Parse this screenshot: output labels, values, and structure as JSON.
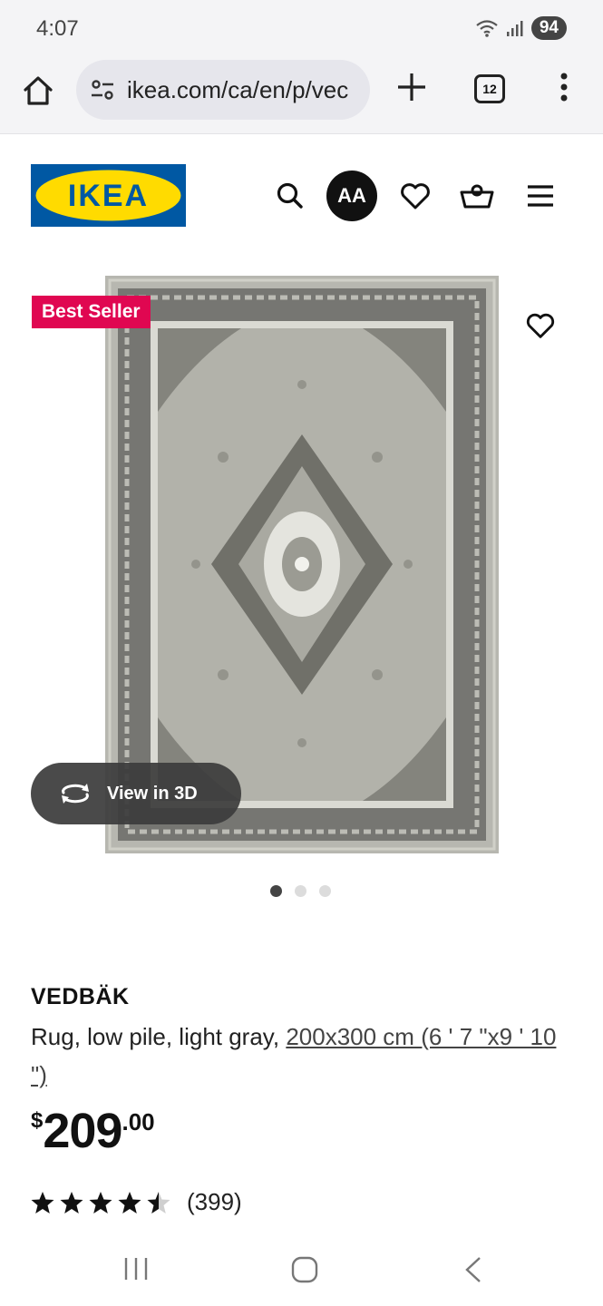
{
  "status": {
    "time": "4:07",
    "battery": "94"
  },
  "browser": {
    "url": "ikea.com/ca/en/p/vec",
    "tab_count": "12"
  },
  "header": {
    "logo_text": "IKEA",
    "avatar_initials": "AA"
  },
  "product": {
    "badge": "Best Seller",
    "view_3d": "View in 3D",
    "image_count": 3,
    "active_image": 1,
    "name": "VEDBÄK",
    "desc_prefix": "Rug, low pile, light gray, ",
    "size_link": "200x300 cm (6 ' 7 \"x9 ' 10 \")",
    "price": {
      "currency": "$",
      "integer": "209",
      "decimal": ".00"
    },
    "rating": {
      "value": 4.5,
      "max": 5,
      "count": "(399)"
    }
  },
  "colors": {
    "ikea_blue": "#0058a3",
    "ikea_yellow": "#ffdb00",
    "badge_red": "#e00751"
  },
  "icons": [
    "home-icon",
    "site-settings-icon",
    "new-tab-icon",
    "tab-switcher-icon",
    "more-menu-icon",
    "search-icon",
    "avatar",
    "heart-icon",
    "cart-icon",
    "hamburger-icon",
    "rotate-3d-icon",
    "star-icon"
  ]
}
